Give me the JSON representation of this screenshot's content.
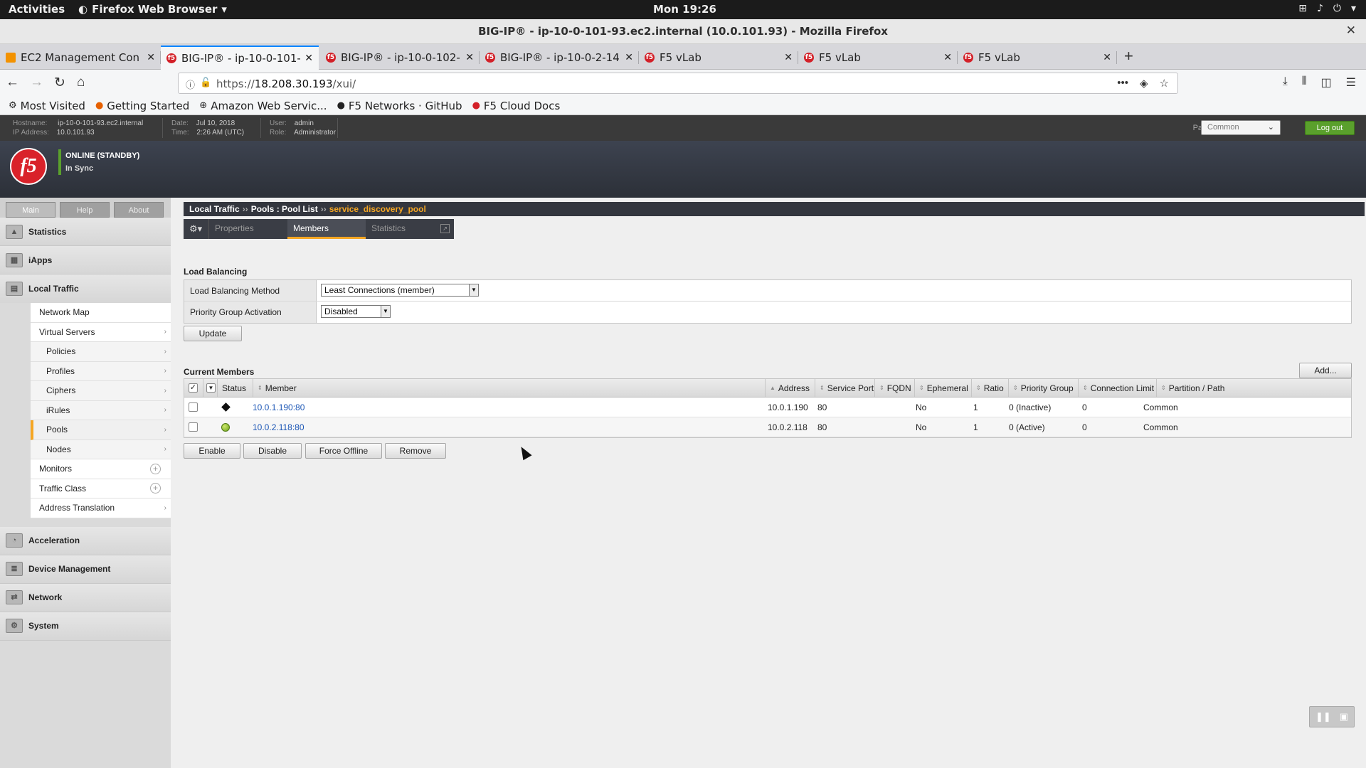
{
  "gnome": {
    "activities": "Activities",
    "app": "Firefox Web Browser",
    "clock": "Mon 19:26"
  },
  "window": {
    "title": "BIG-IP® - ip-10-0-101-93.ec2.internal (10.0.101.93) - Mozilla Firefox"
  },
  "tabs": [
    {
      "label": "EC2 Management Con"
    },
    {
      "label": "BIG-IP® - ip-10-0-101-"
    },
    {
      "label": "BIG-IP® - ip-10-0-102-"
    },
    {
      "label": "BIG-IP® - ip-10-0-2-14"
    },
    {
      "label": "F5 vLab"
    },
    {
      "label": "F5 vLab"
    },
    {
      "label": "F5 vLab"
    }
  ],
  "url": {
    "prefix": "https://",
    "host": "18.208.30.193",
    "path": "/xui/"
  },
  "bookmarks": [
    {
      "label": "Most Visited"
    },
    {
      "label": "Getting Started"
    },
    {
      "label": "Amazon Web Servic..."
    },
    {
      "label": "F5 Networks · GitHub"
    },
    {
      "label": "F5 Cloud Docs"
    }
  ],
  "header": {
    "hostname_label": "Hostname:",
    "hostname": "ip-10-0-101-93.ec2.internal",
    "ip_label": "IP Address:",
    "ip": "10.0.101.93",
    "date_label": "Date:",
    "date": "Jul 10, 2018",
    "time_label": "Time:",
    "time": "2:26 AM (UTC)",
    "user_label": "User:",
    "user": "admin",
    "role_label": "Role:",
    "role": "Administrator",
    "partition_label": "Partition:",
    "partition": "Common",
    "logout": "Log out",
    "status": "ONLINE (STANDBY)",
    "sync": "In Sync",
    "logo": "f5"
  },
  "lefttabs": [
    "Main",
    "Help",
    "About"
  ],
  "nav": {
    "statistics": "Statistics",
    "iapps": "iApps",
    "local_traffic": "Local Traffic",
    "sub": [
      {
        "label": "Network Map"
      },
      {
        "label": "Virtual Servers"
      },
      {
        "label": "Policies"
      },
      {
        "label": "Profiles"
      },
      {
        "label": "Ciphers"
      },
      {
        "label": "iRules"
      },
      {
        "label": "Pools"
      },
      {
        "label": "Nodes"
      },
      {
        "label": "Monitors"
      },
      {
        "label": "Traffic Class"
      },
      {
        "label": "Address Translation"
      }
    ],
    "acceleration": "Acceleration",
    "device_management": "Device Management",
    "network": "Network",
    "system": "System"
  },
  "breadcrumb": {
    "a": "Local Traffic",
    "b": "Pools : Pool List",
    "current": "service_discovery_pool"
  },
  "subtabs": [
    "Properties",
    "Members",
    "Statistics"
  ],
  "lb": {
    "title": "Load Balancing",
    "method_label": "Load Balancing Method",
    "method_value": "Least Connections (member)",
    "pga_label": "Priority Group Activation",
    "pga_value": "Disabled",
    "update": "Update"
  },
  "members": {
    "title": "Current Members",
    "add": "Add...",
    "columns": {
      "status": "Status",
      "member": "Member",
      "address": "Address",
      "service_port": "Service Port",
      "fqdn": "FQDN",
      "ephemeral": "Ephemeral",
      "ratio": "Ratio",
      "priority_group": "Priority Group",
      "connection_limit": "Connection Limit",
      "partition_path": "Partition / Path"
    },
    "rows": [
      {
        "status": "diamond",
        "member": "10.0.1.190:80",
        "address": "10.0.1.190",
        "port": "80",
        "fqdn": "",
        "ephemeral": "No",
        "ratio": "1",
        "priority": "0  (Inactive)",
        "connlimit": "0",
        "partition": "Common"
      },
      {
        "status": "green",
        "member": "10.0.2.118:80",
        "address": "10.0.2.118",
        "port": "80",
        "fqdn": "",
        "ephemeral": "No",
        "ratio": "1",
        "priority": "0  (Active)",
        "connlimit": "0",
        "partition": "Common"
      }
    ],
    "buttons": {
      "enable": "Enable",
      "disable": "Disable",
      "force_offline": "Force Offline",
      "remove": "Remove"
    }
  },
  "colors": {
    "accent": "#f5a623",
    "f5_red": "#d9222a",
    "logout_green": "#5aa02c",
    "tab_active": "#0a84ff"
  }
}
